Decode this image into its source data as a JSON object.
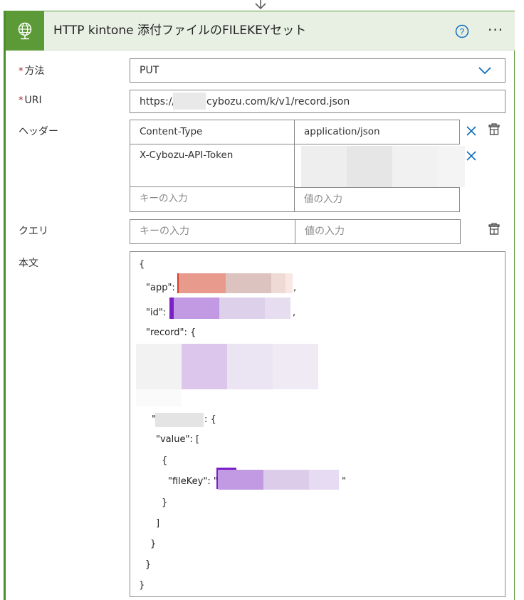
{
  "card": {
    "title": "HTTP kintone 添付ファイルのFILEKEYセット",
    "icon": "globe-icon",
    "accent_color": "#5b9a36"
  },
  "fields": {
    "method": {
      "label": "方法",
      "required_mark": "*",
      "value": "PUT"
    },
    "uri": {
      "label": "URI",
      "required_mark": "*",
      "value_prefix": "https://",
      "value_suffix": "cybozu.com/k/v1/record.json"
    },
    "headers": {
      "label": "ヘッダー",
      "rows": [
        {
          "key": "Content-Type",
          "value": "application/json"
        },
        {
          "key": "X-Cybozu-API-Token",
          "value": ""
        }
      ],
      "key_placeholder": "キーの入力",
      "value_placeholder": "値の入力"
    },
    "query": {
      "label": "クエリ",
      "key_placeholder": "キーの入力",
      "value_placeholder": "値の入力"
    },
    "body": {
      "label": "本文",
      "lines": {
        "open": "{",
        "app_key": "\"app\":",
        "app_tail": ",",
        "id_key": "\"id\":",
        "id_tail": ",",
        "record_key": "\"record\": {",
        "field_quote": "\"",
        "field_tail": ": {",
        "value_key": "\"value\": [",
        "obj_open": "{",
        "filekey_key": "\"fileKey\": \"",
        "filekey_tail": "\"",
        "obj_close": "}",
        "arr_close": "]",
        "field_close": "}",
        "record_close": "}",
        "close": "}"
      }
    }
  }
}
